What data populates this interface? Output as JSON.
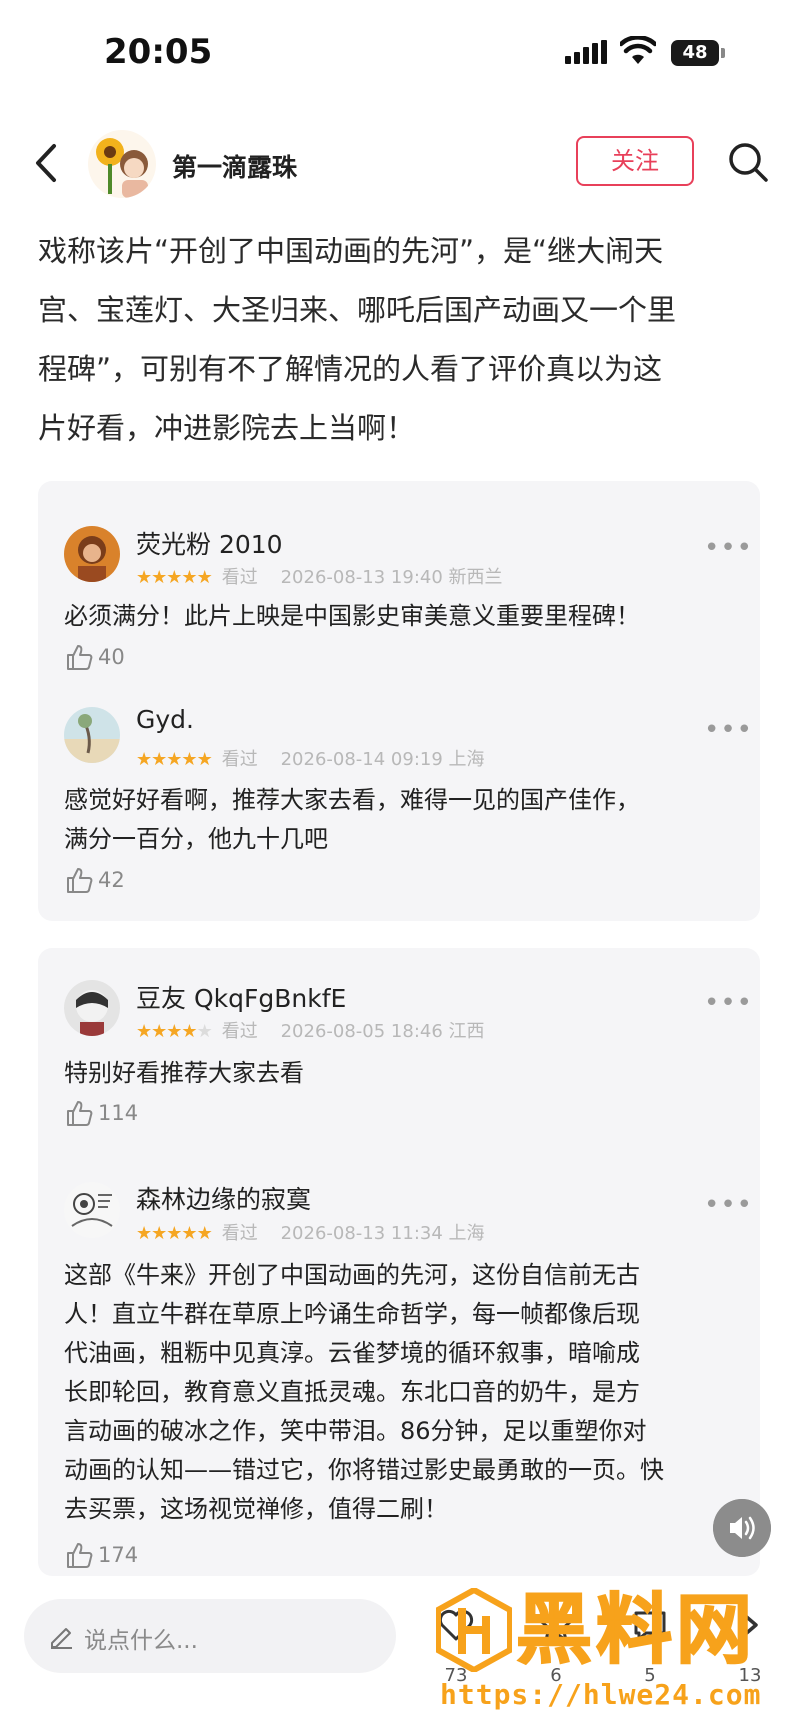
{
  "status_bar": {
    "time": "20:05",
    "battery": "48"
  },
  "nav": {
    "author_name": "第一滴露珠",
    "follow_label": "关注"
  },
  "post": {
    "lines": [
      "戏称该片“开创了中国动画的先河”，是“继大闹天",
      "宫、宝莲灯、大圣归来、哪吒后国产动画又一个里",
      "程碑”，可别有不了解情况的人看了评价真以为这",
      "片好看，冲进影院去上当啊！"
    ]
  },
  "comments": [
    {
      "name": "荧光粉 2010",
      "rating": 5,
      "status": "看过",
      "time": "2026-08-13 19:40",
      "location": "新西兰",
      "text": [
        "必须满分！此片上映是中国影史审美意义重要里程碑！"
      ],
      "likes": "40",
      "more": "•••"
    },
    {
      "name": "Gyd.",
      "rating": 5,
      "status": "看过",
      "time": "2026-08-14 09:19",
      "location": "上海",
      "text": [
        "感觉好好看啊，推荐大家去看，难得一见的国产佳作，",
        "满分一百分，他九十几吧"
      ],
      "likes": "42",
      "more": "•••"
    },
    {
      "name": "豆友 QkqFgBnkfE",
      "rating": 4,
      "status": "看过",
      "time": "2026-08-05 18:46",
      "location": "江西",
      "text": [
        "特别好看推荐大家去看"
      ],
      "likes": "114",
      "more": "•••"
    },
    {
      "name": "森林边缘的寂寞",
      "rating": 5,
      "status": "看过",
      "time": "2026-08-13 11:34",
      "location": "上海",
      "text": [
        "这部《牛来》开创了中国动画的先河，这份自信前无古",
        "人！直立牛群在草原上吟诵生命哲学，每一帧都像后现",
        "代油画，粗粝中见真淳。云雀梦境的循环叙事，暗喻成",
        "长即轮回，教育意义直抵灵魂。东北口音的奶牛，是方",
        "言动画的破冰之作，笑中带泪。86分钟，足以重塑你对",
        "动画的认知——错过它，你将错过影史最勇敢的一页。快",
        "去买票，这场视觉禅修，值得二刷！"
      ],
      "likes": "174",
      "more": "•••"
    }
  ],
  "bottom_bar": {
    "input_placeholder": "说点什么...",
    "actions": [
      {
        "icon": "heart-icon",
        "count": "73"
      },
      {
        "icon": "star-icon",
        "count": "6"
      },
      {
        "icon": "comment-icon",
        "count": "5"
      },
      {
        "icon": "share-icon",
        "count": "13"
      }
    ]
  },
  "watermark": {
    "title": "黑料网",
    "url": "https://hlwe24.com"
  },
  "colors": {
    "accent": "#e8405a",
    "star": "#f5a623",
    "watermark": "#f7a21b"
  }
}
